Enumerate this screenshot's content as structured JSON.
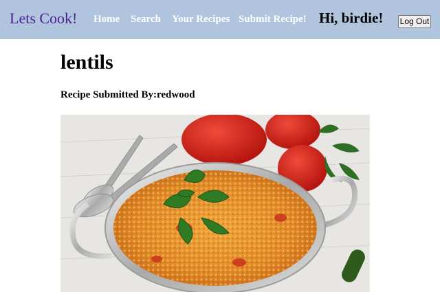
{
  "nav": {
    "brand": "Lets Cook!",
    "links": [
      "Home",
      "Search",
      "Your Recipes",
      "Submit Recipe!"
    ],
    "greeting": "Hi, birdie!",
    "logout_label": "Log Out"
  },
  "recipe": {
    "title": "lentils",
    "submitted_label": "Recipe Submitted By:",
    "submitted_by": "redwood",
    "image_icon": "dal-dish-photo"
  },
  "colors": {
    "navbar_bg": "#b0c4de",
    "brand": "#4b1f8f",
    "nav_link": "#ffffff"
  }
}
